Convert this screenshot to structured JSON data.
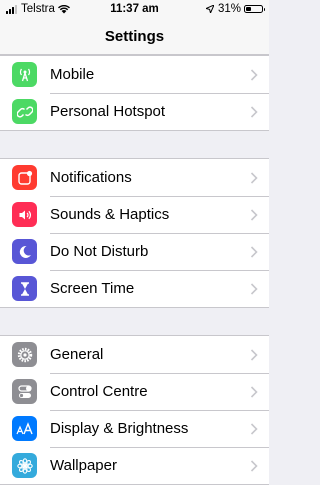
{
  "status_bar": {
    "carrier": "Telstra",
    "time": "11:37 am",
    "battery_percent": "31%",
    "battery_level": 0.31
  },
  "nav": {
    "title": "Settings"
  },
  "groups": [
    {
      "items": [
        {
          "label": "Mobile",
          "icon": "antenna-icon",
          "color": "#4cd964"
        },
        {
          "label": "Personal Hotspot",
          "icon": "hotspot-icon",
          "color": "#4cd964"
        }
      ]
    },
    {
      "items": [
        {
          "label": "Notifications",
          "icon": "notifications-icon",
          "color": "#ff3b30"
        },
        {
          "label": "Sounds & Haptics",
          "icon": "speaker-icon",
          "color": "#ff2d55"
        },
        {
          "label": "Do Not Disturb",
          "icon": "moon-icon",
          "color": "#5856d6"
        },
        {
          "label": "Screen Time",
          "icon": "hourglass-icon",
          "color": "#5856d6"
        }
      ]
    },
    {
      "items": [
        {
          "label": "General",
          "icon": "gear-icon",
          "color": "#8e8e93"
        },
        {
          "label": "Control Centre",
          "icon": "toggles-icon",
          "color": "#8e8e93"
        },
        {
          "label": "Display & Brightness",
          "icon": "text-size-icon",
          "color": "#007aff"
        },
        {
          "label": "Wallpaper",
          "icon": "flower-icon",
          "color": "#34aadc"
        }
      ]
    }
  ]
}
